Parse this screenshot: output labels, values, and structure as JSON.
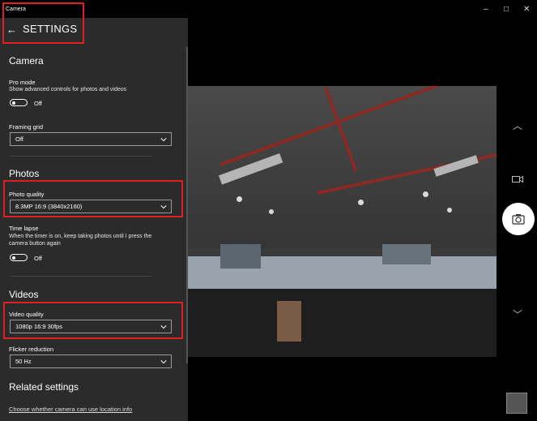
{
  "window": {
    "app_title": "Camera",
    "minimize": "–",
    "maximize": "□",
    "close": "✕"
  },
  "header": {
    "back_icon": "←",
    "title": "SETTINGS"
  },
  "camera": {
    "heading": "Camera",
    "pro_mode": {
      "label": "Pro mode",
      "description": "Show advanced controls for photos and videos",
      "state": "Off"
    },
    "framing_grid": {
      "label": "Framing grid",
      "value": "Off"
    }
  },
  "photos": {
    "heading": "Photos",
    "photo_quality": {
      "label": "Photo quality",
      "value": "8.3MP 16:9 (3840x2160)"
    },
    "time_lapse": {
      "label": "Time lapse",
      "description_line1": "When the timer is on, keep taking photos until I press the",
      "description_line2": "camera button again",
      "state": "Off"
    }
  },
  "videos": {
    "heading": "Videos",
    "video_quality": {
      "label": "Video quality",
      "value": "1080p 16:9 30fps"
    },
    "flicker_reduction": {
      "label": "Flicker reduction",
      "value": "50 Hz"
    }
  },
  "related": {
    "heading": "Related settings",
    "location_link": "Choose whether camera can use location info"
  },
  "controls": {
    "up_chevron": "︿",
    "down_chevron": "﹀",
    "video_mode": "video-camera-icon",
    "photo_mode": "camera-icon"
  },
  "colors": {
    "panel_bg": "#2b2b2b",
    "highlight": "#e02020",
    "background": "#000000"
  }
}
